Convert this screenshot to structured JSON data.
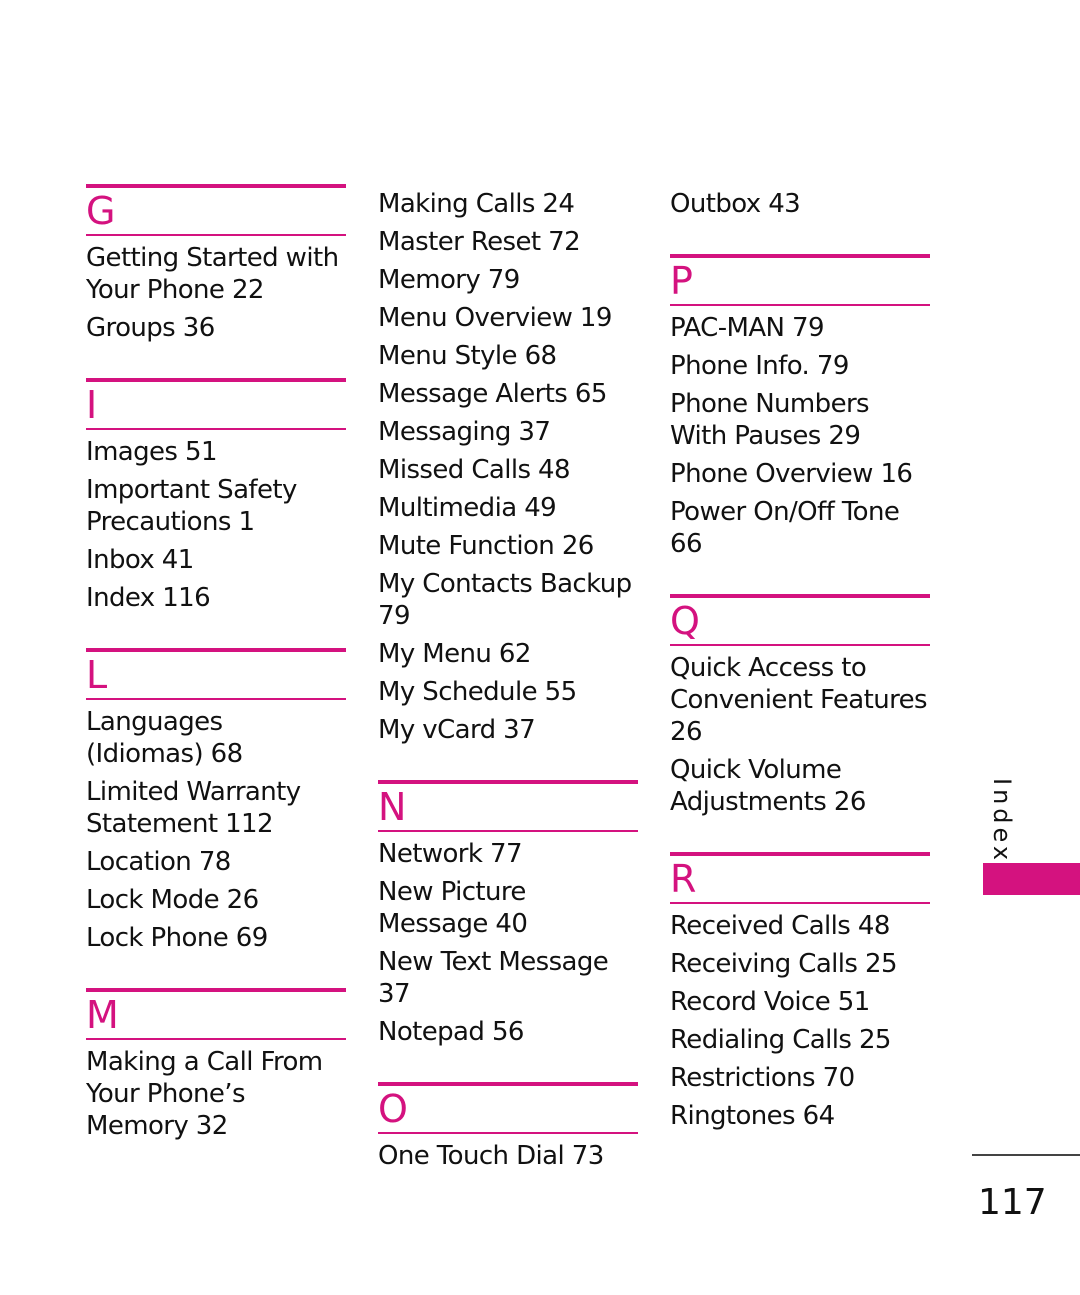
{
  "accent_color": "#d4127f",
  "columns": [
    {
      "sections": [
        {
          "letter": "G",
          "entries": [
            "Getting Started with Your Phone 22",
            "Groups 36"
          ]
        },
        {
          "letter": "I",
          "entries": [
            "Images 51",
            "Important Safety Precautions 1",
            "Inbox 41",
            "Index 116"
          ]
        },
        {
          "letter": "L",
          "entries": [
            "Languages (Idiomas) 68",
            "Limited Warranty Statement 112",
            "Location 78",
            "Lock Mode 26",
            "Lock Phone 69"
          ]
        },
        {
          "letter": "M",
          "entries": [
            "Making a Call From Your Phone’s Memory 32"
          ]
        }
      ]
    },
    {
      "continued": [
        "Making Calls 24",
        "Master Reset 72",
        "Memory 79",
        "Menu Overview 19",
        "Menu Style 68",
        "Message Alerts 65",
        "Messaging 37",
        "Missed Calls 48",
        "Multimedia 49",
        "Mute Function 26",
        "My Contacts Backup 79",
        "My Menu 62",
        "My Schedule 55",
        "My vCard 37"
      ],
      "sections": [
        {
          "letter": "N",
          "entries": [
            "Network 77",
            "New Picture Message 40",
            "New Text Message 37",
            "Notepad 56"
          ]
        },
        {
          "letter": "O",
          "entries": [
            "One Touch Dial 73"
          ]
        }
      ]
    },
    {
      "continued": [
        "Outbox 43"
      ],
      "sections": [
        {
          "letter": "P",
          "entries": [
            "PAC-MAN 79",
            "Phone Info. 79",
            "Phone Numbers With Pauses 29",
            "Phone Overview 16",
            "Power On/Off Tone 66"
          ]
        },
        {
          "letter": "Q",
          "entries": [
            "Quick Access to Convenient Features 26",
            "Quick Volume Adjustments 26"
          ]
        },
        {
          "letter": "R",
          "entries": [
            "Received Calls 48",
            "Receiving Calls 25",
            "Record Voice 51",
            "Redialing Calls 25",
            "Restrictions 70",
            "Ringtones 64"
          ]
        }
      ]
    }
  ],
  "side_tab": {
    "label": "Index"
  },
  "page_number": "117"
}
